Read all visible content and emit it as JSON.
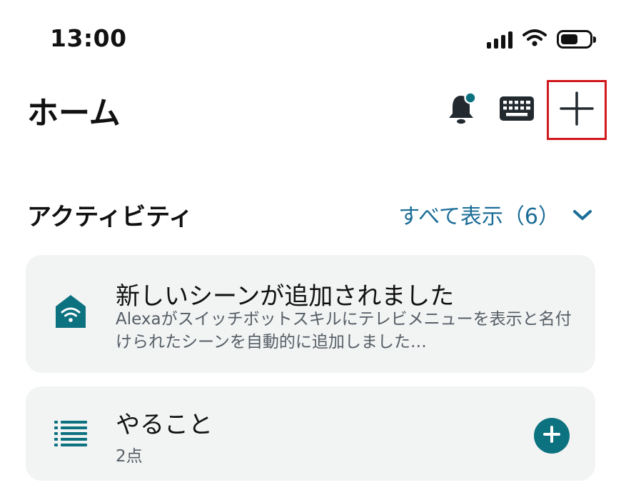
{
  "status_bar": {
    "time": "13:00",
    "icons": [
      "cellular-signal-icon",
      "wifi-icon",
      "battery-icon"
    ]
  },
  "header": {
    "title": "ホーム",
    "actions": [
      "bell-notification-icon",
      "keyboard-icon",
      "add-icon"
    ]
  },
  "activity": {
    "section_title": "アクティビティ",
    "show_all_label": "すべて表示（6）",
    "cards": [
      {
        "icon": "smart-home-wifi-icon",
        "title": "新しいシーンが追加されました",
        "description": "Alexaがスイッチボットスキルにテレビメニューを表示と名付けられたシーンを自動的に追加しました…"
      },
      {
        "icon": "list-icon",
        "title": "やること",
        "subtitle": "2点",
        "action_icon": "plus-circle-icon"
      }
    ]
  },
  "colors": {
    "accent": "#0d7280",
    "link": "#1b6d97",
    "card_bg": "#f2f3f3",
    "highlight": "#d0181d"
  }
}
